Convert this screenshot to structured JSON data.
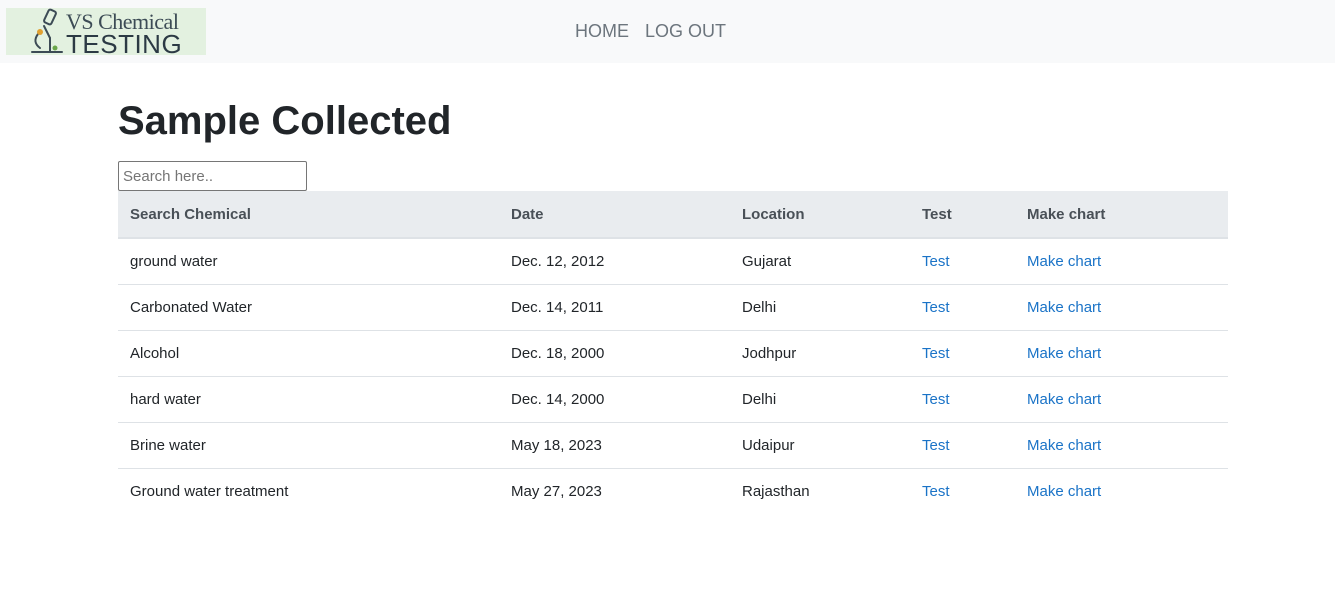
{
  "brand": {
    "line1": "VS Chemical",
    "line2": "TESTING",
    "icon": "microscope-icon"
  },
  "nav": {
    "home": "HOME",
    "logout": "LOG OUT"
  },
  "page": {
    "title": "Sample Collected"
  },
  "search": {
    "placeholder": "Search here..",
    "value": ""
  },
  "table": {
    "headers": [
      "Search Chemical",
      "Date",
      "Location",
      "Test",
      "Make chart"
    ],
    "rows": [
      {
        "chemical": "ground water",
        "date": "Dec. 12, 2012",
        "location": "Gujarat",
        "test": "Test",
        "chart": "Make chart"
      },
      {
        "chemical": "Carbonated Water",
        "date": "Dec. 14, 2011",
        "location": "Delhi",
        "test": "Test",
        "chart": "Make chart"
      },
      {
        "chemical": "Alcohol",
        "date": "Dec. 18, 2000",
        "location": "Jodhpur",
        "test": "Test",
        "chart": "Make chart"
      },
      {
        "chemical": "hard water",
        "date": "Dec. 14, 2000",
        "location": "Delhi",
        "test": "Test",
        "chart": "Make chart"
      },
      {
        "chemical": "Brine water",
        "date": "May 18, 2023",
        "location": "Udaipur",
        "test": "Test",
        "chart": "Make chart"
      },
      {
        "chemical": "Ground water treatment",
        "date": "May 27, 2023",
        "location": "Rajasthan",
        "test": "Test",
        "chart": "Make chart"
      }
    ]
  },
  "colors": {
    "navbar_bg": "#f8f9fa",
    "link": "#1a73c7",
    "header_bg": "#e9ecef"
  }
}
